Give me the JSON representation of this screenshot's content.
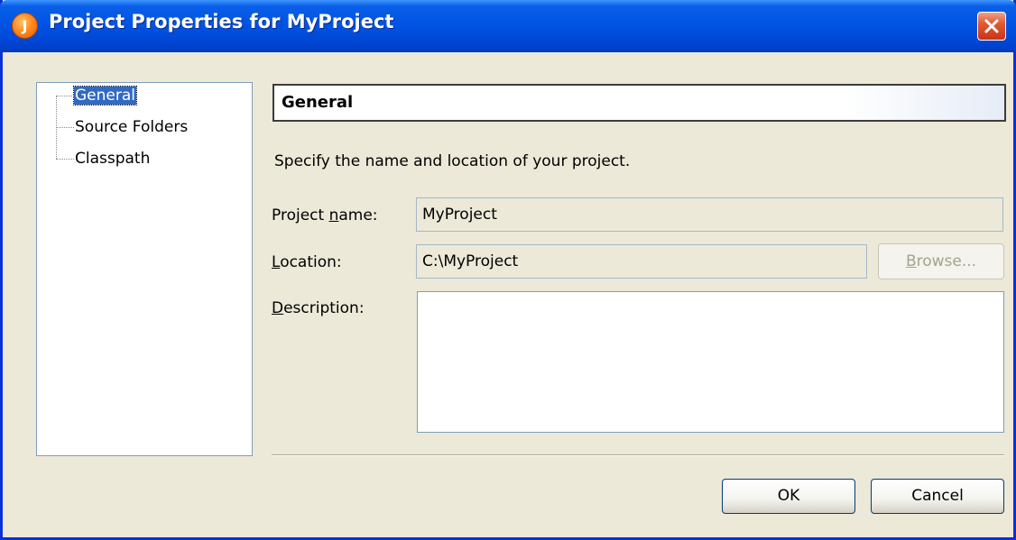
{
  "window": {
    "title": "Project Properties for MyProject",
    "app_icon_glyph": "J"
  },
  "tree": {
    "items": [
      {
        "label": "General",
        "selected": true
      },
      {
        "label": "Source Folders",
        "selected": false
      },
      {
        "label": "Classpath",
        "selected": false
      }
    ]
  },
  "panel": {
    "header": "General",
    "description": "Specify the name and location of your project.",
    "fields": {
      "project_name": {
        "label_pre": "Project ",
        "label_mnemonic": "n",
        "label_post": "ame:",
        "value": "MyProject"
      },
      "location": {
        "label_pre": "",
        "label_mnemonic": "L",
        "label_post": "ocation:",
        "value": "C:\\MyProject"
      },
      "description": {
        "label_pre": "",
        "label_mnemonic": "D",
        "label_post": "escription:",
        "value": ""
      }
    },
    "browse_button": {
      "mnemonic": "B",
      "rest": "rowse...",
      "enabled": false
    }
  },
  "buttons": {
    "ok": "OK",
    "cancel": "Cancel"
  },
  "colors": {
    "titlebar": "#0054e3",
    "selection": "#316ac5",
    "window_bg": "#ece9d8",
    "close": "#e15a33"
  }
}
